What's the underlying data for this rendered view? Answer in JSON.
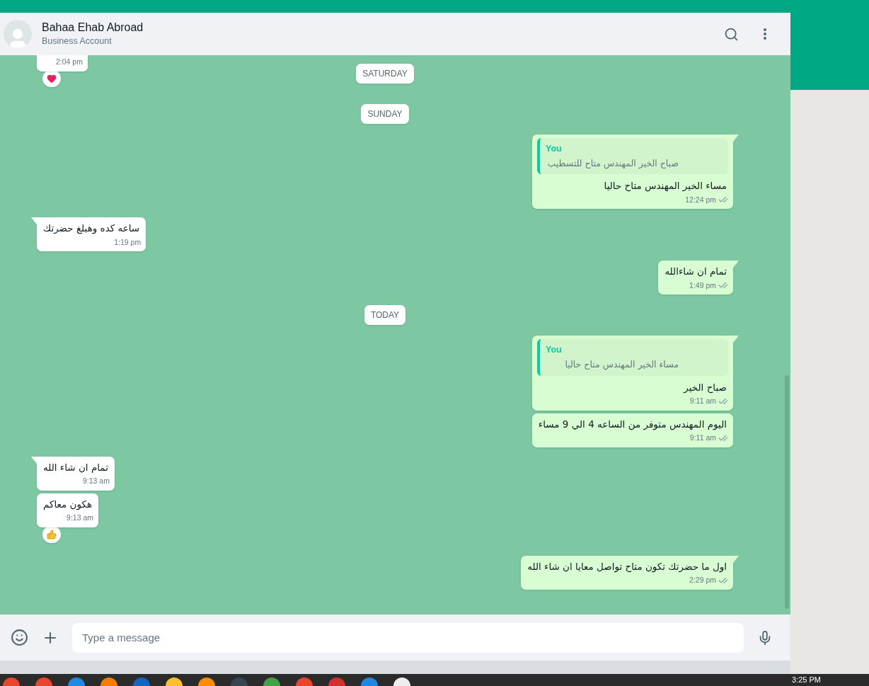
{
  "contact": {
    "name": "Bahaa Ehab Abroad",
    "subtitle": "Business Account"
  },
  "messages": [
    {
      "kind": "in",
      "time": "2:04 pm",
      "reaction": {
        "kind": "heart"
      },
      "cut": true
    },
    {
      "kind": "date",
      "text": "SATURDAY"
    },
    {
      "kind": "date",
      "text": "SUNDAY"
    },
    {
      "kind": "out",
      "quote": {
        "author": "You",
        "text": "صباح الخير المهندس متاح للتسطيب"
      },
      "text": "مساء الخير المهندس متاح حاليا",
      "time": "12:24 pm",
      "read": false,
      "tail": true
    },
    {
      "kind": "in",
      "text": "ساعه كده وهبلغ حضرتك",
      "time": "1:19 pm",
      "tail": true
    },
    {
      "kind": "out",
      "text": "تمام ان شاءالله",
      "time": "1:49 pm",
      "read": false,
      "tail": true
    },
    {
      "kind": "date",
      "text": "TODAY"
    },
    {
      "kind": "out",
      "quote": {
        "author": "You",
        "text": "مساء الخير المهندس متاح حاليا"
      },
      "text": "صباح الخير",
      "time": "9:11 am",
      "read": false,
      "tail": true
    },
    {
      "kind": "out",
      "text": "اليوم المهندس متوفر من الساعه 4 الي 9 مساء",
      "time": "9:11 am",
      "read": false,
      "tail": false
    },
    {
      "kind": "in",
      "text": "تمام ان شاء الله",
      "time": "9:13 am",
      "tail": true
    },
    {
      "kind": "in",
      "text": "هكون معاكم",
      "time": "9:13 am",
      "reaction": {
        "kind": "thumbs-up"
      },
      "tail": false
    },
    {
      "kind": "out",
      "text": "اول ما حضرتك تكون متاح تواصل معايا ان شاء الله",
      "time": "2:29 pm",
      "read": false,
      "tail": true
    }
  ],
  "composer": {
    "placeholder": "Type a message"
  },
  "taskbar": {
    "clock": "3:25 PM"
  }
}
